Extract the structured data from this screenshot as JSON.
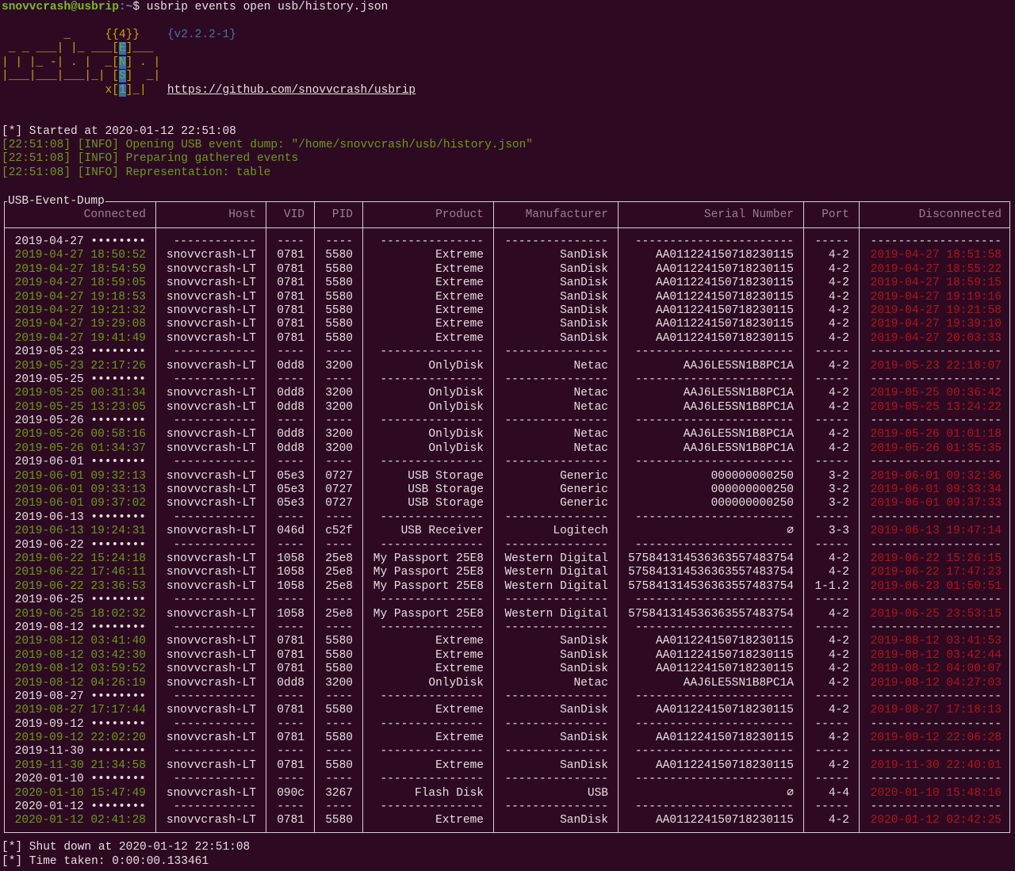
{
  "terminal": {
    "prompt_user": "snovvcrash@usbrip",
    "prompt_path": ":~",
    "prompt_symbol": "$ ",
    "command": "usbrip events open usb/history.json"
  },
  "banner": {
    "logo_lines": [
      "         _     ",
      " _ _ ___| |_ ___",
      "| | |_ -| . |  _",
      "|___|___|___|_| ",
      "               x"
    ],
    "logo_tails": [
      "",
      "___",
      " . |",
      "  _|",
      "_|"
    ],
    "logo_badge": "{{4}}",
    "logo_letters": [
      "E",
      "N",
      "S",
      "1"
    ],
    "version": "{v2.2.2-1}",
    "url": "https://github.com/snovvcrash/usbrip"
  },
  "log": {
    "started": "[*] Started at 2020-01-12 22:51:08",
    "info": [
      "[22:51:08] [INFO] Opening USB event dump: \"/home/snovvcrash/usb/history.json\"",
      "[22:51:08] [INFO] Preparing gathered events",
      "[22:51:08] [INFO] Representation: table"
    ],
    "shutdown": "[*] Shut down at 2020-01-12 22:51:08",
    "time_taken": "[*] Time taken: 0:00:00.133461"
  },
  "table": {
    "title": "USB-Event-Dump",
    "columns": [
      "Connected",
      "Host",
      "VID",
      "PID",
      "Product",
      "Manufacturer",
      "Serial Number",
      "Port",
      "Disconnected"
    ],
    "date_mask": "••••••••",
    "separator_char": "-",
    "groups": [
      {
        "date": "2019-04-27",
        "rows": [
          [
            "2019-04-27 18:50:52",
            "snovvcrash-LT",
            "0781",
            "5580",
            "Extreme",
            "SanDisk",
            "AA011224150718230115",
            "4-2",
            "2019-04-27 18:51:58"
          ],
          [
            "2019-04-27 18:54:59",
            "snovvcrash-LT",
            "0781",
            "5580",
            "Extreme",
            "SanDisk",
            "AA011224150718230115",
            "4-2",
            "2019-04-27 18:55:22"
          ],
          [
            "2019-04-27 18:59:05",
            "snovvcrash-LT",
            "0781",
            "5580",
            "Extreme",
            "SanDisk",
            "AA011224150718230115",
            "4-2",
            "2019-04-27 18:59:15"
          ],
          [
            "2019-04-27 19:18:53",
            "snovvcrash-LT",
            "0781",
            "5580",
            "Extreme",
            "SanDisk",
            "AA011224150718230115",
            "4-2",
            "2019-04-27 19:19:16"
          ],
          [
            "2019-04-27 19:21:32",
            "snovvcrash-LT",
            "0781",
            "5580",
            "Extreme",
            "SanDisk",
            "AA011224150718230115",
            "4-2",
            "2019-04-27 19:21:58"
          ],
          [
            "2019-04-27 19:29:08",
            "snovvcrash-LT",
            "0781",
            "5580",
            "Extreme",
            "SanDisk",
            "AA011224150718230115",
            "4-2",
            "2019-04-27 19:39:10"
          ],
          [
            "2019-04-27 19:41:49",
            "snovvcrash-LT",
            "0781",
            "5580",
            "Extreme",
            "SanDisk",
            "AA011224150718230115",
            "4-2",
            "2019-04-27 20:03:33"
          ]
        ]
      },
      {
        "date": "2019-05-23",
        "rows": [
          [
            "2019-05-23 22:17:26",
            "snovvcrash-LT",
            "0dd8",
            "3200",
            "OnlyDisk",
            "Netac",
            "AAJ6LE5SN1B8PC1A",
            "4-2",
            "2019-05-23 22:18:07"
          ]
        ]
      },
      {
        "date": "2019-05-25",
        "rows": [
          [
            "2019-05-25 00:31:34",
            "snovvcrash-LT",
            "0dd8",
            "3200",
            "OnlyDisk",
            "Netac",
            "AAJ6LE5SN1B8PC1A",
            "4-2",
            "2019-05-25 00:36:42"
          ],
          [
            "2019-05-25 13:23:05",
            "snovvcrash-LT",
            "0dd8",
            "3200",
            "OnlyDisk",
            "Netac",
            "AAJ6LE5SN1B8PC1A",
            "4-2",
            "2019-05-25 13:24:22"
          ]
        ]
      },
      {
        "date": "2019-05-26",
        "rows": [
          [
            "2019-05-26 00:58:16",
            "snovvcrash-LT",
            "0dd8",
            "3200",
            "OnlyDisk",
            "Netac",
            "AAJ6LE5SN1B8PC1A",
            "4-2",
            "2019-05-26 01:01:18"
          ],
          [
            "2019-05-26 01:34:37",
            "snovvcrash-LT",
            "0dd8",
            "3200",
            "OnlyDisk",
            "Netac",
            "AAJ6LE5SN1B8PC1A",
            "4-2",
            "2019-05-26 01:35:35"
          ]
        ]
      },
      {
        "date": "2019-06-01",
        "rows": [
          [
            "2019-06-01 09:32:13",
            "snovvcrash-LT",
            "05e3",
            "0727",
            "USB Storage",
            "Generic",
            "000000000250",
            "3-2",
            "2019-06-01 09:32:36"
          ],
          [
            "2019-06-01 09:33:13",
            "snovvcrash-LT",
            "05e3",
            "0727",
            "USB Storage",
            "Generic",
            "000000000250",
            "3-2",
            "2019-06-01 09:33:34"
          ],
          [
            "2019-06-01 09:37:02",
            "snovvcrash-LT",
            "05e3",
            "0727",
            "USB Storage",
            "Generic",
            "000000000250",
            "3-2",
            "2019-06-01 09:37:33"
          ]
        ]
      },
      {
        "date": "2019-06-13",
        "rows": [
          [
            "2019-06-13 19:24:31",
            "snovvcrash-LT",
            "046d",
            "c52f",
            "USB Receiver",
            "Logitech",
            "∅",
            "3-3",
            "2019-06-13 19:47:14"
          ]
        ]
      },
      {
        "date": "2019-06-22",
        "rows": [
          [
            "2019-06-22 15:24:18",
            "snovvcrash-LT",
            "1058",
            "25e8",
            "My Passport 25E8",
            "Western Digital",
            "575841314536363557483754",
            "4-2",
            "2019-06-22 15:26:15"
          ],
          [
            "2019-06-22 17:46:11",
            "snovvcrash-LT",
            "1058",
            "25e8",
            "My Passport 25E8",
            "Western Digital",
            "575841314536363557483754",
            "4-2",
            "2019-06-22 17:47:23"
          ],
          [
            "2019-06-22 23:36:53",
            "snovvcrash-LT",
            "1058",
            "25e8",
            "My Passport 25E8",
            "Western Digital",
            "575841314536363557483754",
            "1-1.2",
            "2019-06-23 01:50:51"
          ]
        ]
      },
      {
        "date": "2019-06-25",
        "rows": [
          [
            "2019-06-25 18:02:32",
            "snovvcrash-LT",
            "1058",
            "25e8",
            "My Passport 25E8",
            "Western Digital",
            "575841314536363557483754",
            "4-2",
            "2019-06-25 23:53:15"
          ]
        ]
      },
      {
        "date": "2019-08-12",
        "rows": [
          [
            "2019-08-12 03:41:40",
            "snovvcrash-LT",
            "0781",
            "5580",
            "Extreme",
            "SanDisk",
            "AA011224150718230115",
            "4-2",
            "2019-08-12 03:41:53"
          ],
          [
            "2019-08-12 03:42:30",
            "snovvcrash-LT",
            "0781",
            "5580",
            "Extreme",
            "SanDisk",
            "AA011224150718230115",
            "4-2",
            "2019-08-12 03:42:44"
          ],
          [
            "2019-08-12 03:59:52",
            "snovvcrash-LT",
            "0781",
            "5580",
            "Extreme",
            "SanDisk",
            "AA011224150718230115",
            "4-2",
            "2019-08-12 04:00:07"
          ],
          [
            "2019-08-12 04:26:19",
            "snovvcrash-LT",
            "0dd8",
            "3200",
            "OnlyDisk",
            "Netac",
            "AAJ6LE5SN1B8PC1A",
            "4-2",
            "2019-08-12 04:27:03"
          ]
        ]
      },
      {
        "date": "2019-08-27",
        "rows": [
          [
            "2019-08-27 17:17:44",
            "snovvcrash-LT",
            "0781",
            "5580",
            "Extreme",
            "SanDisk",
            "AA011224150718230115",
            "4-2",
            "2019-08-27 17:18:13"
          ]
        ]
      },
      {
        "date": "2019-09-12",
        "rows": [
          [
            "2019-09-12 22:02:20",
            "snovvcrash-LT",
            "0781",
            "5580",
            "Extreme",
            "SanDisk",
            "AA011224150718230115",
            "4-2",
            "2019-09-12 22:06:28"
          ]
        ]
      },
      {
        "date": "2019-11-30",
        "rows": [
          [
            "2019-11-30 21:34:58",
            "snovvcrash-LT",
            "0781",
            "5580",
            "Extreme",
            "SanDisk",
            "AA011224150718230115",
            "4-2",
            "2019-11-30 22:40:01"
          ]
        ]
      },
      {
        "date": "2020-01-10",
        "rows": [
          [
            "2020-01-10 15:47:49",
            "snovvcrash-LT",
            "090c",
            "3267",
            "Flash Disk",
            "USB",
            "∅",
            "4-4",
            "2020-01-10 15:48:16"
          ]
        ]
      },
      {
        "date": "2020-01-12",
        "rows": [
          [
            "2020-01-12 02:41:28",
            "snovvcrash-LT",
            "0781",
            "5580",
            "Extreme",
            "SanDisk",
            "AA011224150718230115",
            "4-2",
            "2020-01-12 02:42:25"
          ]
        ]
      }
    ]
  },
  "colors": {
    "background": "#2d0a22",
    "connected": "#6e9a1c",
    "disconnected": "#b3141c",
    "header": "#9b7f90"
  }
}
